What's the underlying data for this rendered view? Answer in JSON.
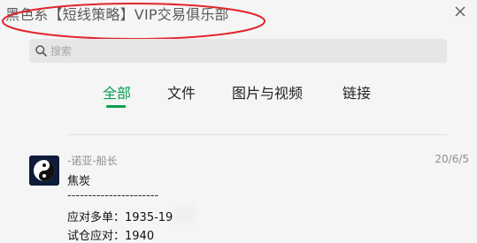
{
  "window": {
    "title": "黑色系【短线策略】VIP交易俱乐部",
    "close_icon": "close-icon"
  },
  "annotation": {
    "color": "#e0262b"
  },
  "search": {
    "placeholder": "搜索",
    "value": ""
  },
  "tabs": [
    {
      "label": "全部",
      "active": true
    },
    {
      "label": "文件",
      "active": false
    },
    {
      "label": "图片与视频",
      "active": false
    },
    {
      "label": "链接",
      "active": false
    }
  ],
  "accent_color": "#07a050",
  "message": {
    "sender": "-诺亚-船长",
    "date": "20/6/5",
    "avatar_icon": "yin-yang-icon",
    "lines": [
      "焦炭",
      "----------------------",
      "应对多单：1935-19",
      "试仓应对：1940"
    ]
  }
}
